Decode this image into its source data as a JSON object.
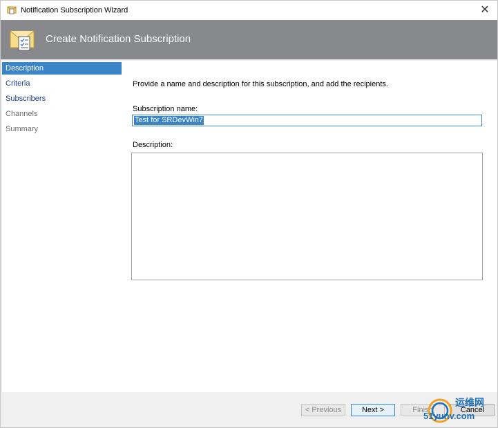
{
  "window": {
    "title": "Notification Subscription Wizard",
    "close_glyph": "✕"
  },
  "header": {
    "title": "Create Notification Subscription",
    "icon": "envelope-checklist-icon"
  },
  "nav": {
    "items": [
      {
        "label": "Description",
        "state": "active"
      },
      {
        "label": "Criteria",
        "state": "link"
      },
      {
        "label": "Subscribers",
        "state": "link"
      },
      {
        "label": "Channels",
        "state": "disabled"
      },
      {
        "label": "Summary",
        "state": "disabled"
      }
    ]
  },
  "content": {
    "intro": "Provide a name and description for this subscription, and add the recipients.",
    "name_label": "Subscription name:",
    "name_value": "Test for SRDevWin7",
    "description_label": "Description:",
    "description_value": ""
  },
  "footer": {
    "previous_label": "< Previous",
    "next_label": "Next >",
    "finish_label": "Finish",
    "cancel_label": "Cancel"
  },
  "watermark": {
    "cn_text": "运维网",
    "en_text": "51yunv.com"
  },
  "colors": {
    "accent": "#3c84c8",
    "header_bg": "#87898c",
    "link": "#1a3d8f"
  }
}
